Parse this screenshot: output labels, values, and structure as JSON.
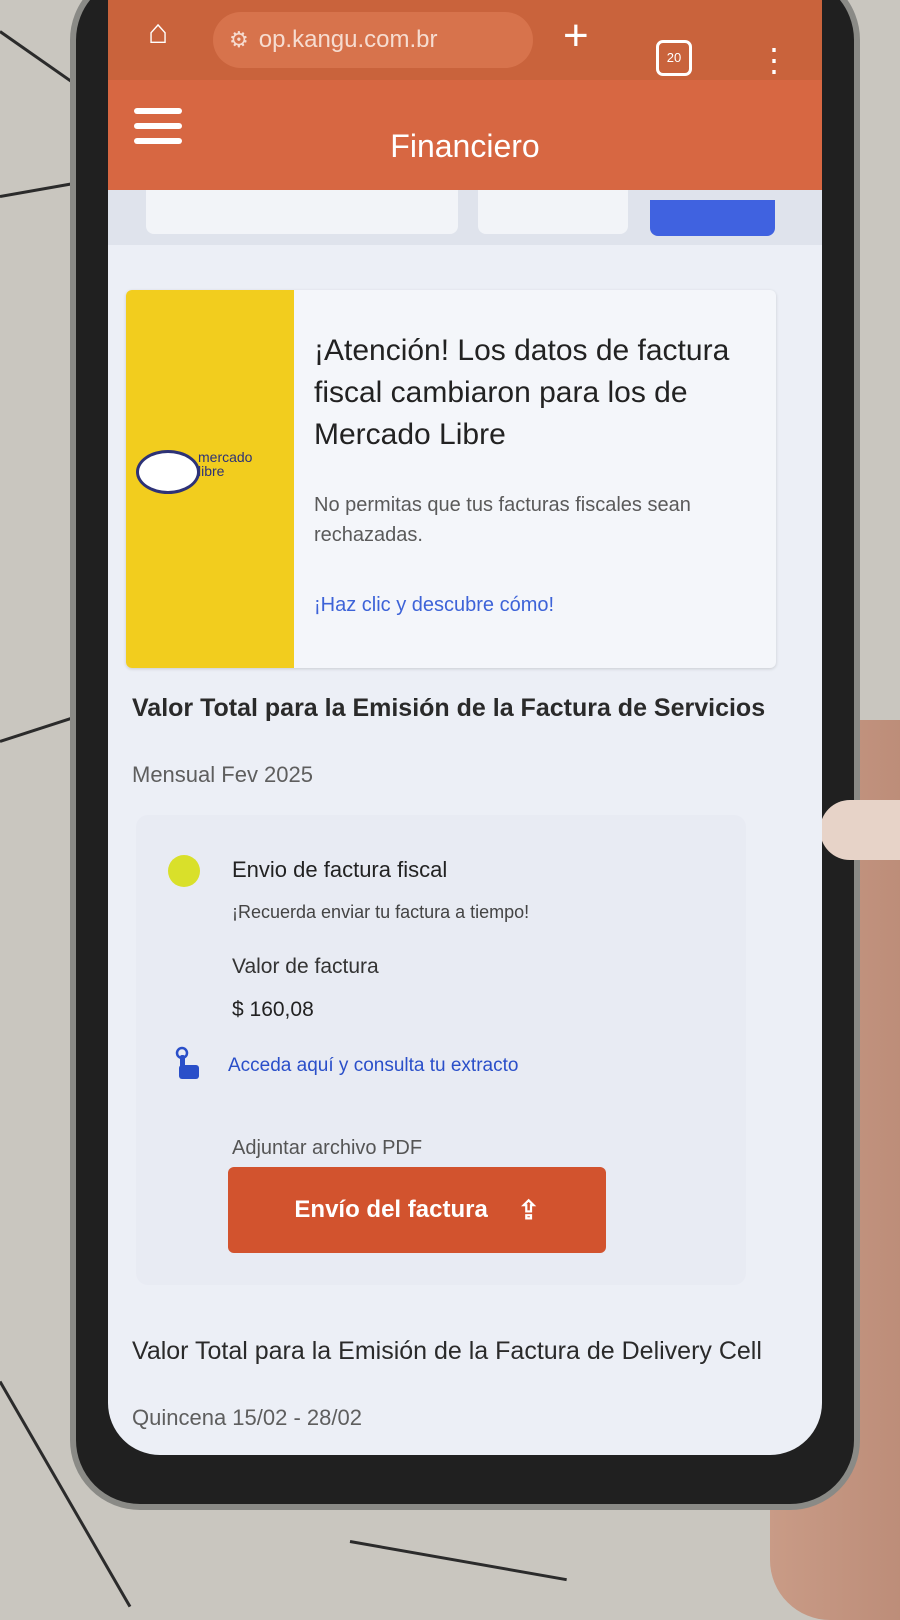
{
  "browser": {
    "url": "op.kangu.com.br",
    "tab_count": "20",
    "home_icon": "home-icon",
    "menu_icon": "more-vert-icon"
  },
  "header": {
    "title": "Financiero",
    "menu_icon": "hamburger-icon"
  },
  "banner": {
    "logo_text_line1": "mercado",
    "logo_text_line2": "libre",
    "title": "¡Atención! Los datos de factura fiscal cambiaron para los de Mercado Libre",
    "subtitle": "No permitas que tus facturas fiscales sean rechazadas.",
    "link": "¡Haz clic y descubre cómo!"
  },
  "section_services": {
    "title": "Valor Total para la Emisión de la Factura de Servicios",
    "period": "Mensual Fev 2025",
    "card": {
      "heading": "Envio de factura fiscal",
      "reminder": "¡Recuerda enviar tu factura a tiempo!",
      "value_label": "Valor de factura",
      "value": "$ 160,08",
      "extract_link": "Acceda aquí y consulta tu extracto",
      "attach_label": "Adjuntar archivo PDF",
      "upload_button": "Envío del factura",
      "status_color": "#d9e02a"
    }
  },
  "section_delivery": {
    "title": "Valor Total para la Emisión de la Factura de Delivery Cell",
    "period": "Quincena 15/02 - 28/02"
  },
  "colors": {
    "brand": "#d76742",
    "button": "#d2532e",
    "link": "#3d63d8",
    "mercado_libre_yellow": "#f2cd1e"
  }
}
